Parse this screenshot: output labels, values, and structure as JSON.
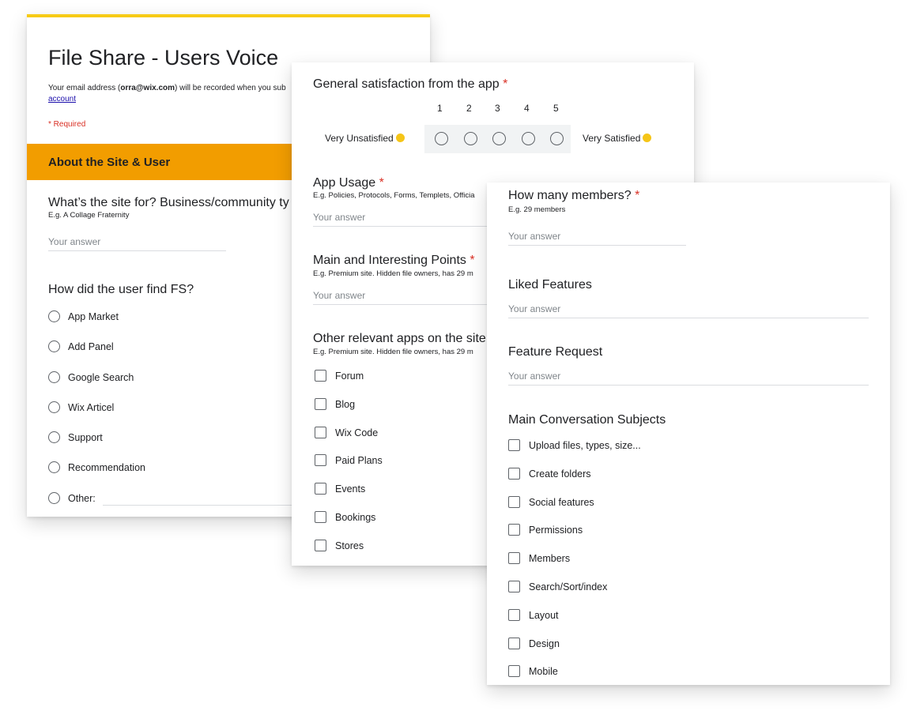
{
  "card1": {
    "form_title": "File Share - Users Voice",
    "email_pre": "Your email address (",
    "email_addr": "orra@wix.com",
    "email_post": ") will be recorded when you sub",
    "account_link": "account",
    "required_note": "* Required",
    "section_title": "About the Site & User",
    "q_site_for": {
      "title": "What’s the site for? Business/community ty",
      "help": "E.g. A Collage Fraternity",
      "placeholder": "Your answer"
    },
    "q_find_fs": {
      "title": "How did the user find FS?",
      "options": [
        "App Market",
        "Add Panel",
        "Google Search",
        "Wix Articel",
        "Support",
        "Recommendation",
        "Other:"
      ]
    }
  },
  "card2": {
    "q_satisfaction": {
      "title": "General satisfaction from the app",
      "required_mark": "*",
      "scale_numbers": [
        "1",
        "2",
        "3",
        "4",
        "5"
      ],
      "low_label": "Very Unsatisfied",
      "high_label": "Very Satisfied"
    },
    "q_usage": {
      "title": "App Usage",
      "required_mark": "*",
      "help": "E.g. Policies, Protocols, Forms, Templets, Officia",
      "placeholder": "Your answer"
    },
    "q_points": {
      "title": "Main and Interesting Points",
      "required_mark": "*",
      "help": "E.g. Premium site. Hidden file owners, has 29 m",
      "placeholder": "Your answer"
    },
    "q_other_apps": {
      "title": "Other relevant apps on the site",
      "help": "E.g. Premium site. Hidden file owners, has 29 m",
      "options": [
        "Forum",
        "Blog",
        "Wix Code",
        "Paid Plans",
        "Events",
        "Bookings",
        "Stores"
      ]
    }
  },
  "card3": {
    "q_members": {
      "title": "How many members?",
      "required_mark": "*",
      "help": "E.g. 29 members",
      "placeholder": "Your answer"
    },
    "q_liked": {
      "title": "Liked Features",
      "placeholder": "Your answer"
    },
    "q_request": {
      "title": "Feature Request",
      "placeholder": "Your answer"
    },
    "q_subjects": {
      "title": "Main Conversation Subjects",
      "options": [
        "Upload files, types, size...",
        "Create folders",
        "Social features",
        "Permissions",
        "Members",
        "Search/Sort/index",
        "Layout",
        "Design",
        "Mobile"
      ]
    }
  },
  "colors": {
    "header_accent": "#f7cb16",
    "section_bar": "#f29d00",
    "required": "#d93025",
    "link": "#1a0dab"
  }
}
